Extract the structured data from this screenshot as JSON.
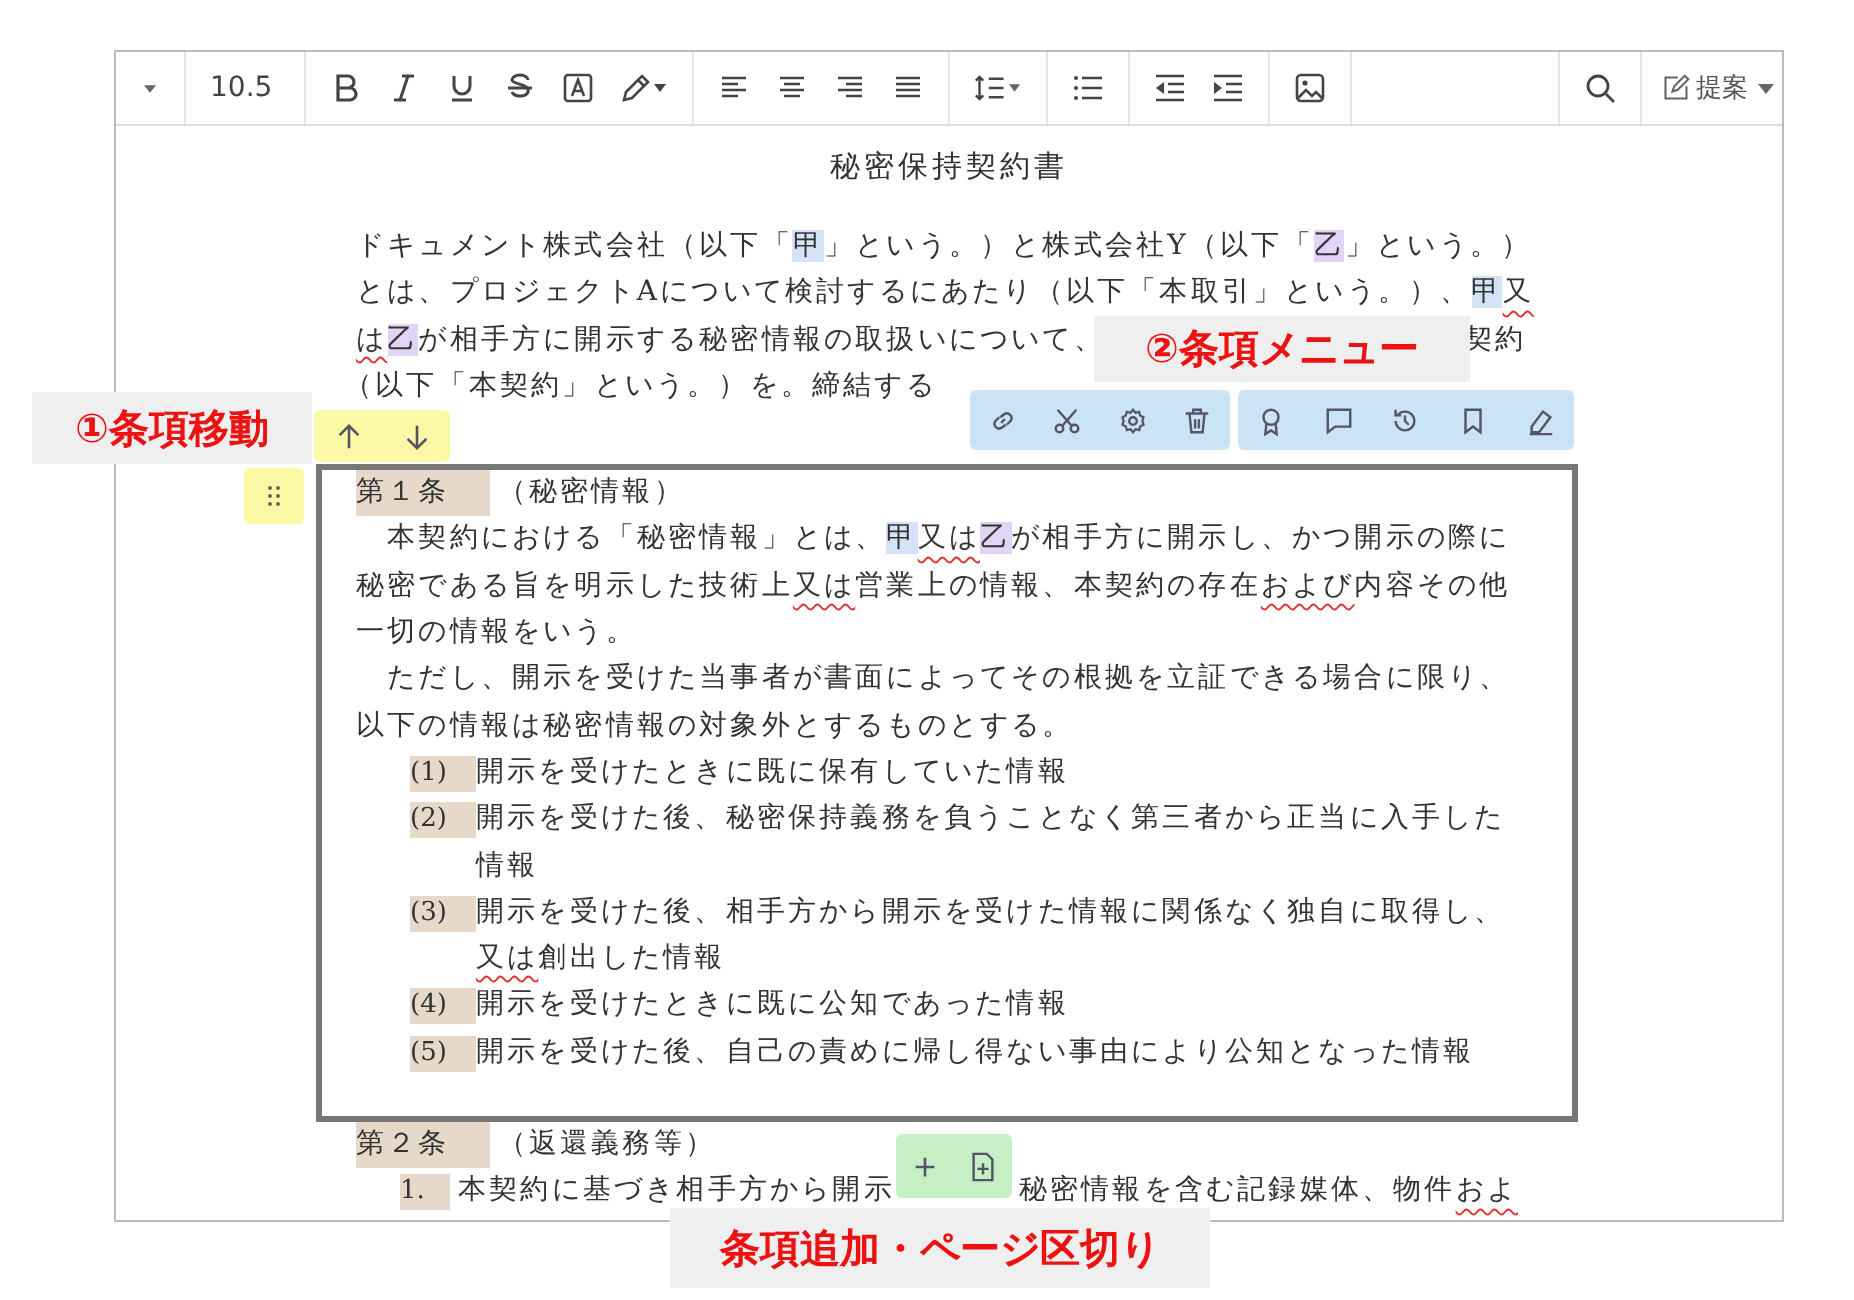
{
  "toolbar": {
    "font_size": "10.5",
    "suggest_label": "提案"
  },
  "title": "秘密保持契約書",
  "intro": [
    [
      [
        "ドキュメント株式会社（以下「",
        {
          "text": "甲",
          "kind": "party-a"
        },
        "」という。）と株式会社Y（以下「",
        {
          "text": "乙",
          "kind": "party-b"
        },
        "」という。）"
      ]
    ],
    [
      [
        "とは、プロジェクトAについて検討するにあたり（以下「本取引」という。）、",
        {
          "text": "甲",
          "kind": "party-a"
        },
        {
          "text": "又",
          "kind": "squiggle"
        }
      ]
    ],
    [
      [
        {
          "text": "は",
          "kind": "squiggle"
        },
        {
          "text": "乙",
          "kind": "party-b"
        },
        "が相手方に開示する秘密情報の取扱いについて、"
      ],
      [
        "契約"
      ]
    ],
    [
      [
        "（以下「本契約」という。）を。締結する"
      ]
    ]
  ],
  "clauses": [
    {
      "number": "第１条",
      "heading": "（秘密情報）",
      "framed": true,
      "paragraphs": [
        [
          [
            [
              "　本契約における「秘密情報」とは、",
              {
                "text": "甲",
                "kind": "party-a"
              },
              {
                "text": "又は",
                "kind": "squiggle"
              },
              {
                "text": "乙",
                "kind": "party-b"
              },
              "が相手方に開示し、かつ開示の際に"
            ]
          ],
          [
            [
              "秘密である旨を明示した技術上",
              {
                "text": "又は",
                "kind": "squiggle"
              },
              "営業上の情報、本契約の存在",
              {
                "text": "および",
                "kind": "squiggle"
              },
              "内容その他"
            ]
          ],
          [
            [
              "一切の情報をいう。"
            ]
          ]
        ],
        [
          [
            [
              "　ただし、開示を受けた当事者が書面によってその根拠を立証できる場合に限り、"
            ]
          ],
          [
            [
              "以下の情報は秘密情報の対象外とするものとする。"
            ]
          ]
        ]
      ],
      "items": [
        {
          "number": "(1)",
          "lines": [
            [
              [
                "開示を受けたときに既に保有していた情報"
              ]
            ]
          ]
        },
        {
          "number": "(2)",
          "lines": [
            [
              [
                "開示を受けた後、秘密保持義務を負うことなく第三者から正当に入手した"
              ]
            ],
            [
              [
                "情報"
              ]
            ]
          ]
        },
        {
          "number": "(3)",
          "lines": [
            [
              [
                "開示を受けた後、相手方から開示を受けた情報に関係なく独自に取得し、"
              ]
            ],
            [
              [
                {
                  "text": "又は",
                  "kind": "squiggle"
                },
                "創出した情報"
              ]
            ]
          ]
        },
        {
          "number": "(4)",
          "lines": [
            [
              [
                "開示を受けたときに既に公知であった情報"
              ]
            ]
          ]
        },
        {
          "number": "(5)",
          "lines": [
            [
              [
                "開示を受けた後、自己の責めに帰し得ない事由により公知となった情報"
              ]
            ]
          ]
        }
      ]
    },
    {
      "number": "第２条",
      "heading": "（返還義務等）",
      "framed": false,
      "items": [
        {
          "number": "1.",
          "lines": [
            [
              [
                "本契約に基づき相手方から開示"
              ],
              [
                "秘密情報を含む記録媒体、物件",
                {
                  "text": "およ",
                  "kind": "squiggle"
                }
              ]
            ]
          ]
        }
      ]
    }
  ],
  "callouts": [
    {
      "kind": "move",
      "text": "①条項移動"
    },
    {
      "kind": "menu",
      "text": "②条項メニュー"
    },
    {
      "kind": "add",
      "text": "条項追加・ページ区切り"
    }
  ]
}
